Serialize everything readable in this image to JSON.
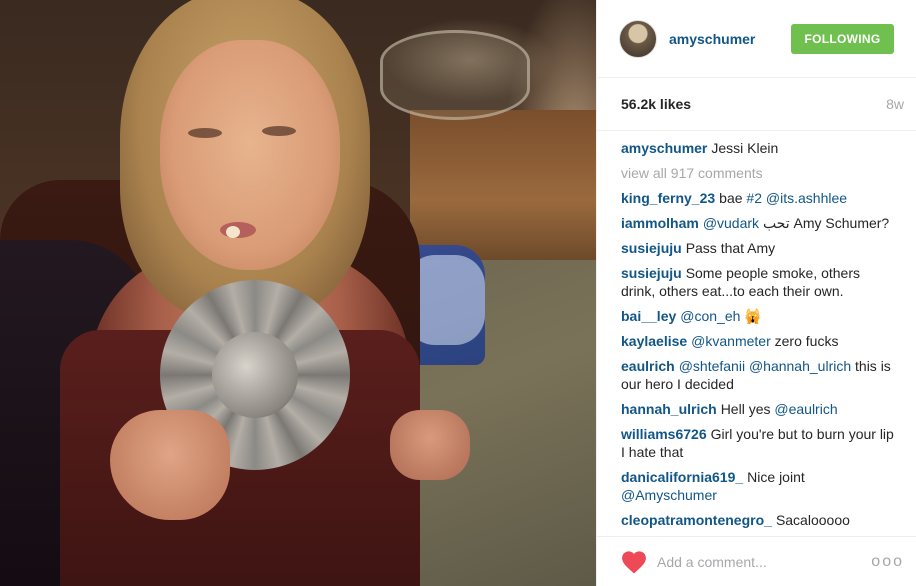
{
  "post": {
    "author": "amyschumer",
    "follow_label": "FOLLOWING",
    "likes": "56.2k likes",
    "age": "8w",
    "caption": {
      "user": "amyschumer",
      "text": "Jessi Klein"
    },
    "view_all": "view all 917 comments",
    "comments": [
      {
        "user": "king_ferny_23",
        "parts": [
          "bae ",
          "#2",
          " ",
          "@its.ashhlee"
        ]
      },
      {
        "user": "iammolham",
        "parts": [
          "@vudark",
          " تحب Amy Schumer?"
        ]
      },
      {
        "user": "susiejuju",
        "parts": [
          "Pass that Amy"
        ]
      },
      {
        "user": "susiejuju",
        "parts": [
          "Some people smoke, others drink, others eat...to each their own."
        ]
      },
      {
        "user": "bai__ley",
        "parts": [
          "@con_eh",
          " 🙀"
        ]
      },
      {
        "user": "kaylaelise",
        "parts": [
          "@kvanmeter",
          " zero fucks"
        ]
      },
      {
        "user": "eaulrich",
        "parts": [
          "@shtefanii",
          " ",
          "@hannah_ulrich",
          " this is our hero I decided"
        ]
      },
      {
        "user": "hannah_ulrich",
        "parts": [
          "Hell yes ",
          "@eaulrich"
        ]
      },
      {
        "user": "williams6726",
        "parts": [
          "Girl you're but to burn your lip I hate that"
        ]
      },
      {
        "user": "danicalifornia619_",
        "parts": [
          "Nice joint ",
          "@Amyschumer"
        ]
      },
      {
        "user": "cleopatramontenegro_",
        "parts": [
          "Sacalooooo"
        ]
      }
    ],
    "add_comment_placeholder": "Add a comment...",
    "more_label": "ooo"
  },
  "colors": {
    "link": "#125688",
    "follow_bg": "#70c050",
    "muted": "#a5a7aa",
    "heart": "#ed4956"
  }
}
